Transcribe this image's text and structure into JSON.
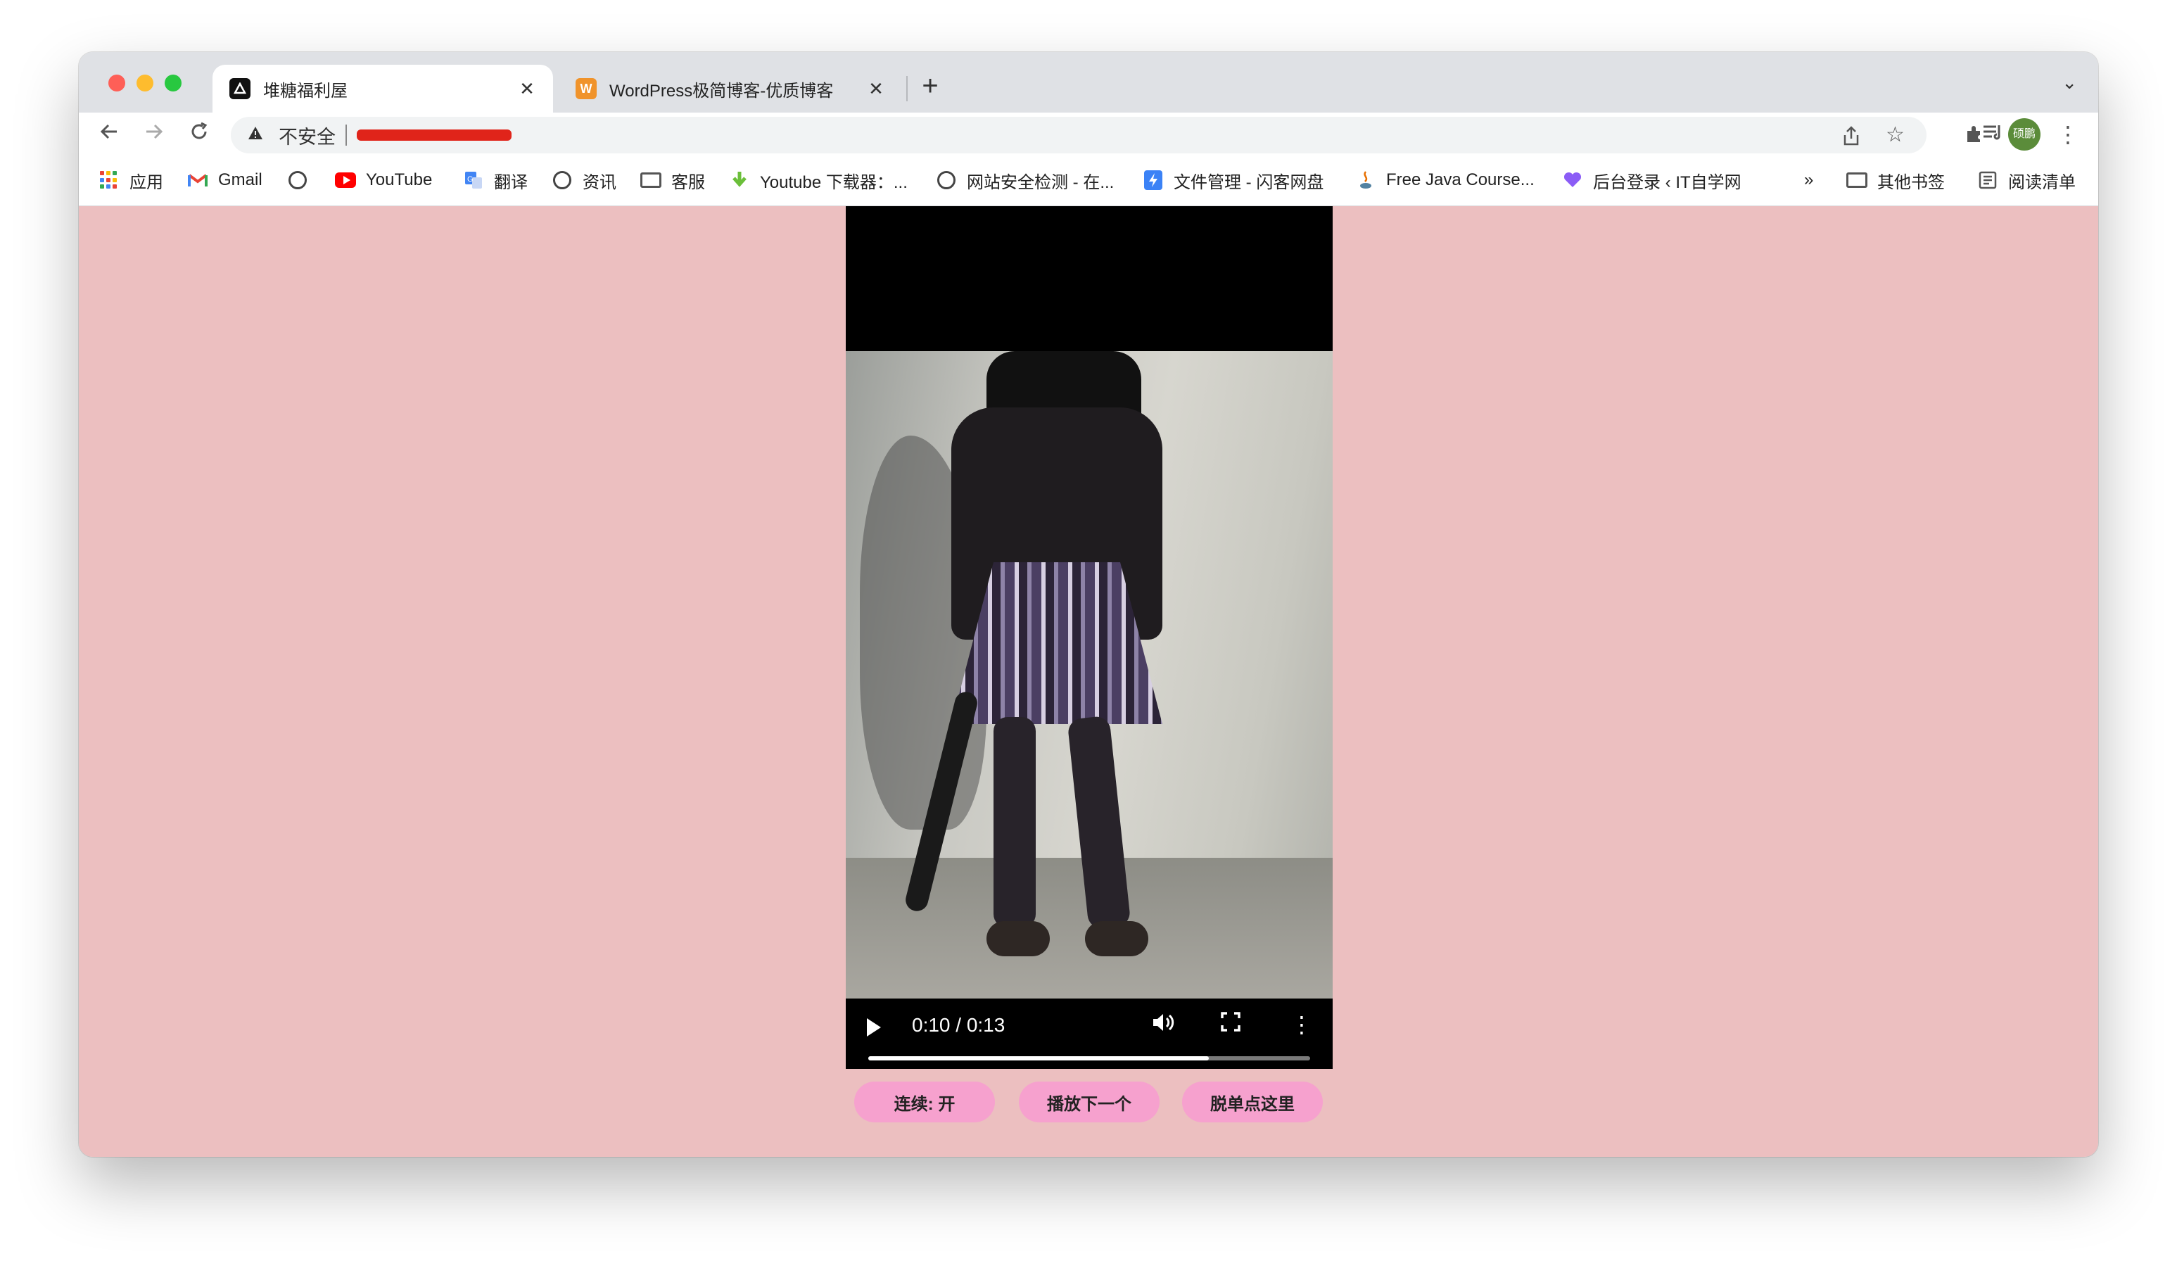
{
  "browser": {
    "tabs": [
      {
        "title": "堆糖福利屋",
        "favicon": "duitang-icon",
        "active": true
      },
      {
        "title": "WordPress极简博客-优质博客",
        "favicon": "W",
        "active": false
      }
    ],
    "close_glyph": "✕",
    "new_tab_glyph": "+",
    "tab_search_glyph": "⌄"
  },
  "toolbar": {
    "security_label": "不安全",
    "url_redacted": true,
    "avatar_text": "硕鹏"
  },
  "bookmarks": {
    "items": [
      {
        "label": "应用",
        "icon": "apps-grid-icon"
      },
      {
        "label": "Gmail",
        "icon": "gmail-icon"
      },
      {
        "label": "",
        "icon": "globe-icon"
      },
      {
        "label": "YouTube",
        "icon": "youtube-icon"
      },
      {
        "label": "翻译",
        "icon": "translate-icon"
      },
      {
        "label": "资讯",
        "icon": "globe-icon"
      },
      {
        "label": "客服",
        "icon": "folder-icon"
      },
      {
        "label": "Youtube 下载器：...",
        "icon": "download-icon"
      },
      {
        "label": "网站安全检测 - 在...",
        "icon": "globe-icon"
      },
      {
        "label": "文件管理 - 闪客网盘",
        "icon": "bolt-icon"
      },
      {
        "label": "Free Java Course...",
        "icon": "java-icon"
      },
      {
        "label": "后台登录 ‹ IT自学网",
        "icon": "heart-icon"
      }
    ],
    "overflow_glyph": "»",
    "other_bookmarks": "其他书签",
    "reading_list": "阅读清单"
  },
  "video": {
    "current_time": "0:10",
    "duration": "0:13",
    "time_display": "0:10 / 0:13",
    "progress_fraction": 0.77
  },
  "buttons": {
    "continuous": "连续: 开",
    "play_next": "播放下一个",
    "escape_single": "脱单点这里"
  },
  "colors": {
    "page_background": "#ecbfc0",
    "button_background": "#f6a1ce"
  }
}
